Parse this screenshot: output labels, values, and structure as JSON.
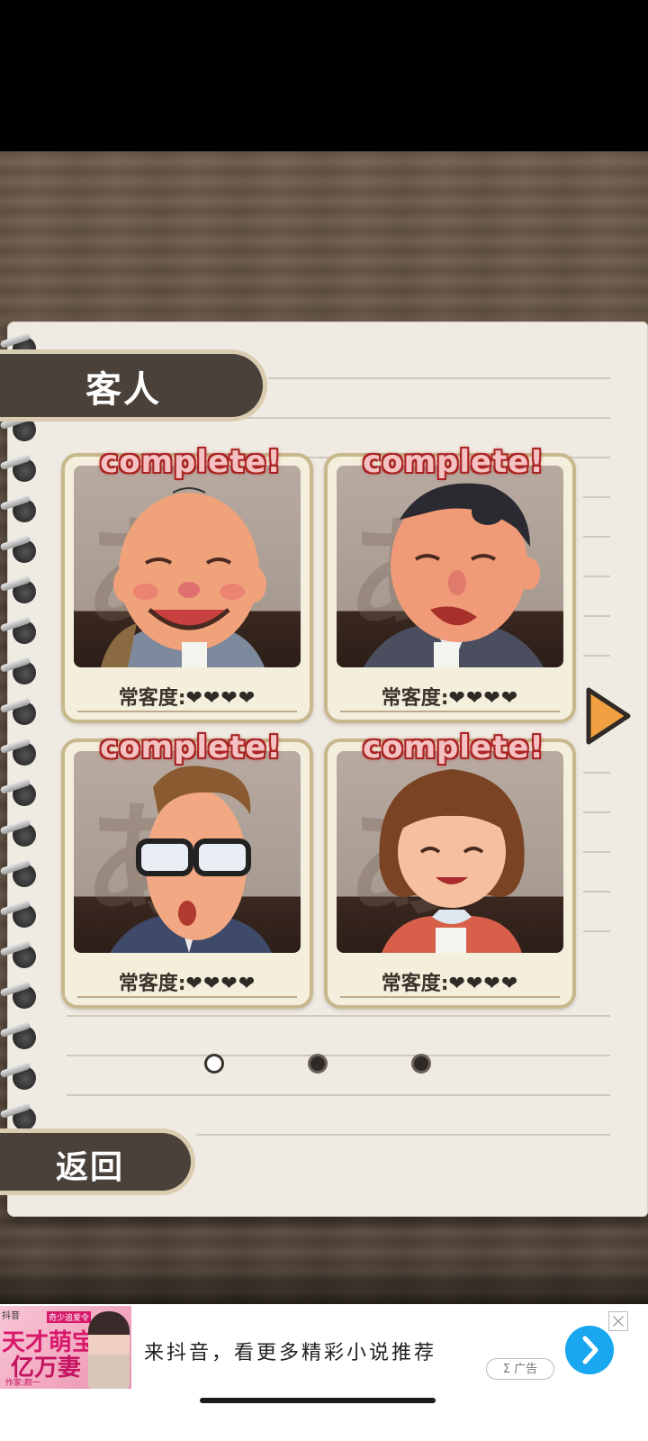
{
  "header": {
    "title": "客人"
  },
  "cards": [
    {
      "status": "complete!",
      "regular_label": "常客度:",
      "hearts": "❤❤❤❤"
    },
    {
      "status": "complete!",
      "regular_label": "常客度:",
      "hearts": "❤❤❤❤"
    },
    {
      "status": "complete!",
      "regular_label": "常客度:",
      "hearts": "❤❤❤❤"
    },
    {
      "status": "complete!",
      "regular_label": "常客度:",
      "hearts": "❤❤❤❤"
    }
  ],
  "pager": {
    "current_page": 1,
    "total_pages": 3
  },
  "footer": {
    "back_label": "返回"
  },
  "ad": {
    "source_label": "抖音",
    "image_title_1": "天才萌宝",
    "image_title_2": "亿万妻",
    "image_tag": "奇少追爱令",
    "image_author": "作家:颜一",
    "headline": "来抖音，看更多精彩小说推荐",
    "badge": "Σ 广告"
  },
  "colors": {
    "tab_bg": "#4a413a",
    "tab_border": "#d9ccb0",
    "complete_text": "#f4c2c2",
    "arrow": "#f0a040",
    "ad_button": "#19a7f0"
  }
}
